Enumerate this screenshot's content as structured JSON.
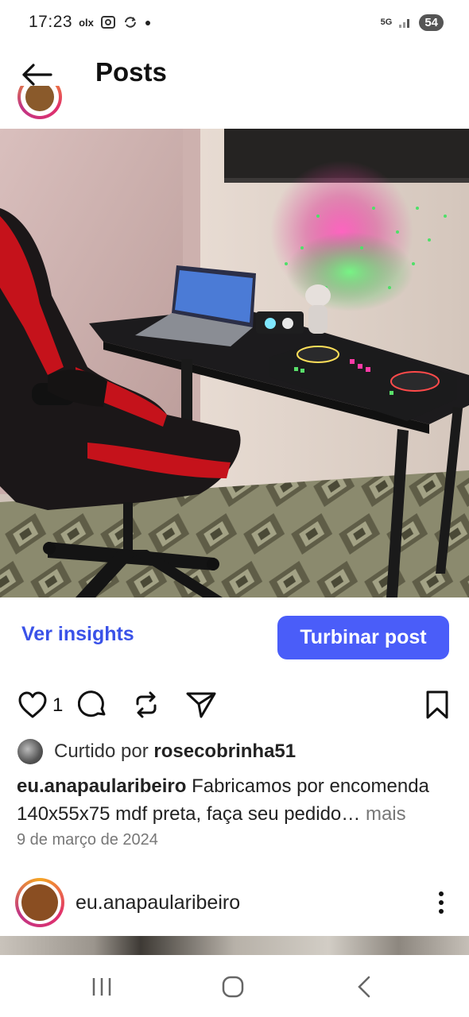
{
  "status_bar": {
    "time": "17:23",
    "app_indicator": "olx",
    "network": "5G",
    "battery": "54"
  },
  "header": {
    "title": "Posts"
  },
  "post": {
    "actions": {
      "insights_label": "Ver insights",
      "boost_label": "Turbinar post"
    },
    "like_count": "1",
    "liked_by_prefix": "Curtido por ",
    "liked_by_user": "rosecobrinha51",
    "caption_user": "eu.anapaularibeiro",
    "caption_text": " Fabricamos por encomenda 140x55x75 mdf preta, faça seu pedido…",
    "caption_more": " mais",
    "date": "9 de março de 2024"
  },
  "next_post": {
    "username": "eu.anapaularibeiro"
  },
  "colors": {
    "accent_blue": "#4a5df9",
    "link_blue": "#3a52e8"
  }
}
